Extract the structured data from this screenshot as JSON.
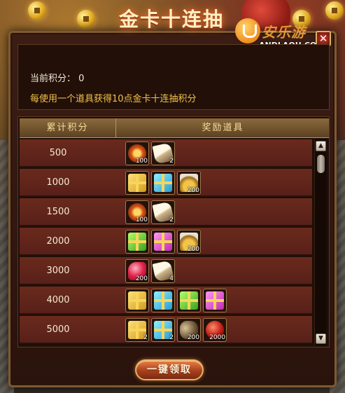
{
  "window": {
    "title": "金卡十连抽",
    "close_glyph": "✕"
  },
  "watermark": {
    "script": "安乐游",
    "text": "ANDLAOU.COM"
  },
  "info": {
    "score_label": "当前积分：",
    "score_value": "0",
    "description": "每使用一个道具获得10点金卡十连抽积分"
  },
  "table": {
    "headers": [
      "累计积分",
      "奖励道具"
    ],
    "rows": [
      {
        "points": "500",
        "items": [
          {
            "icon": "fire-emblem-icon",
            "art": "emblem",
            "qty": "100"
          },
          {
            "icon": "scroll-icon",
            "art": "scroll",
            "qty": "2"
          }
        ]
      },
      {
        "points": "1000",
        "items": [
          {
            "icon": "gold-gift-box-icon",
            "art": "gift-gold",
            "qty": ""
          },
          {
            "icon": "cyan-gift-box-icon",
            "art": "gift-cyan",
            "qty": ""
          },
          {
            "icon": "gold-coins-icon",
            "art": "coins",
            "qty": "200"
          }
        ]
      },
      {
        "points": "1500",
        "items": [
          {
            "icon": "fire-emblem-icon",
            "art": "emblem",
            "qty": "100"
          },
          {
            "icon": "scroll-icon",
            "art": "scroll",
            "qty": "2"
          }
        ]
      },
      {
        "points": "2000",
        "items": [
          {
            "icon": "green-gift-box-icon",
            "art": "gift-green",
            "qty": ""
          },
          {
            "icon": "pink-gift-box-icon",
            "art": "gift-pink",
            "qty": ""
          },
          {
            "icon": "gold-coins-icon",
            "art": "coins",
            "qty": "200"
          }
        ]
      },
      {
        "points": "3000",
        "items": [
          {
            "icon": "ruby-gem-icon",
            "art": "ruby",
            "qty": "200"
          },
          {
            "icon": "scroll-icon",
            "art": "scroll",
            "qty": "4"
          }
        ]
      },
      {
        "points": "4000",
        "items": [
          {
            "icon": "gold-gift-box-icon",
            "art": "gift-gold",
            "qty": ""
          },
          {
            "icon": "cyan-gift-box-icon",
            "art": "gift-cyan",
            "qty": ""
          },
          {
            "icon": "green-gift-box-icon",
            "art": "gift-green",
            "qty": ""
          },
          {
            "icon": "pink-gift-box-icon",
            "art": "gift-pink",
            "qty": ""
          }
        ]
      },
      {
        "points": "5000",
        "items": [
          {
            "icon": "gold-gift-box-icon",
            "art": "gift-gold",
            "qty": "2"
          },
          {
            "icon": "cyan-gift-box-icon",
            "art": "gift-cyan",
            "qty": "2"
          },
          {
            "icon": "ore-icon",
            "art": "ore",
            "qty": "200"
          },
          {
            "icon": "red-orb-icon",
            "art": "redorb",
            "qty": "2000"
          }
        ]
      }
    ]
  },
  "scrollbar": {
    "up_glyph": "▲",
    "down_glyph": "▼"
  },
  "actions": {
    "claim_label": "一键领取"
  }
}
